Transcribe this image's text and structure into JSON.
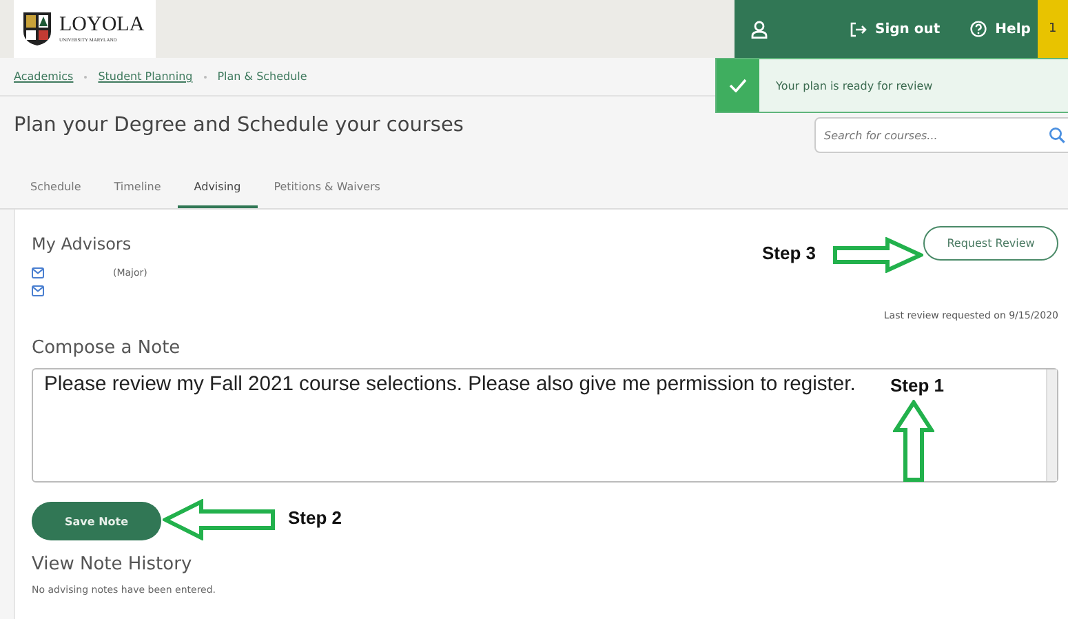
{
  "header": {
    "logo": {
      "name": "LOYOLA",
      "subtitle": "UNIVERSITY MARYLAND"
    },
    "actions": [
      {
        "kind": "user"
      },
      {
        "kind": "signout",
        "label": "Sign out"
      },
      {
        "kind": "help",
        "label": "Help"
      }
    ],
    "badge": "1"
  },
  "breadcrumbs": [
    {
      "label": "Academics",
      "link": true
    },
    {
      "label": "Student Planning",
      "link": true
    },
    {
      "label": "Plan & Schedule",
      "link": false
    }
  ],
  "page_title": "Plan your Degree and Schedule your courses",
  "search": {
    "placeholder": "Search for courses..."
  },
  "toast": {
    "message": "Your plan is ready for review"
  },
  "tabs": [
    {
      "label": "Schedule",
      "selected": false
    },
    {
      "label": "Timeline",
      "selected": false
    },
    {
      "label": "Advising",
      "selected": true
    },
    {
      "label": "Petitions & Waivers",
      "selected": false
    }
  ],
  "advisors": {
    "heading": "My Advisors",
    "rows": [
      {
        "kind": "with_role",
        "role": "(Major)"
      },
      {
        "kind": "email_only"
      }
    ]
  },
  "request_review": "Request Review",
  "last_review": "Last review requested on 9/15/2020",
  "compose": {
    "heading": "Compose a Note",
    "value": "Please review my Fall 2021 course selections. Please also give me permission to register.",
    "button": "Save Note"
  },
  "history": {
    "heading": "View Note History",
    "empty_text": "No advising notes have been entered."
  },
  "annotations": [
    {
      "label": "Step 3",
      "kind": "right"
    },
    {
      "label": "Step 1",
      "kind": "up"
    },
    {
      "label": "Step 2",
      "kind": "left"
    }
  ]
}
